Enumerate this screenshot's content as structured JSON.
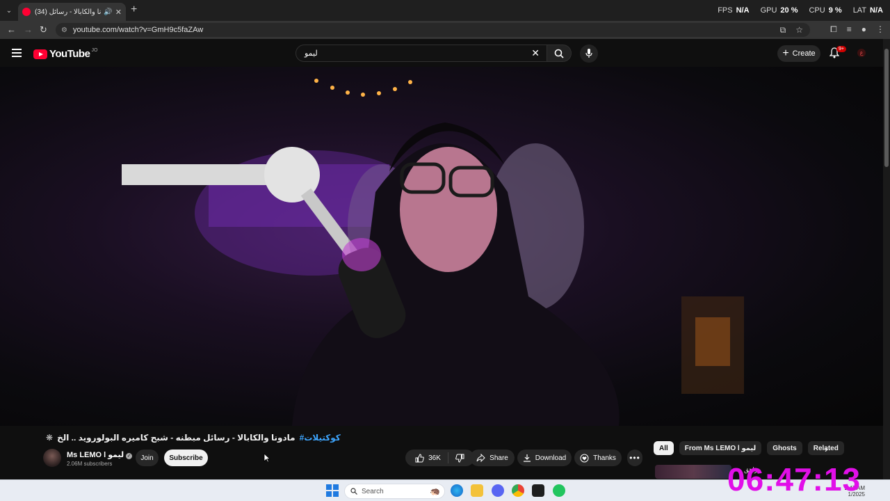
{
  "browser": {
    "tab_title": "(34) مادونا والكابالا - رسائل ...",
    "url": "youtube.com/watch?v=GmH9c5faZAw",
    "stats": [
      {
        "label": "FPS",
        "value": "N/A"
      },
      {
        "label": "GPU",
        "value": "20 %"
      },
      {
        "label": "CPU",
        "value": "9 %"
      },
      {
        "label": "LAT",
        "value": "N/A"
      }
    ]
  },
  "youtube": {
    "logo_text": "YouTube",
    "country_code": "JO",
    "search_value": "ليمو",
    "create_label": "Create",
    "notifications_badge": "9+"
  },
  "video": {
    "title_hashtag": "#كوكتيلات",
    "title_text": "مادونا والكابالا - رسائل مبطنه - شبح كاميره البولورويد .. الخ",
    "channel_name": "Ms LEMO l ليمو",
    "subscribers": "2.06M subscribers",
    "join_label": "Join",
    "subscribe_label": "Subscribe",
    "likes": "36K",
    "share_label": "Share",
    "download_label": "Download",
    "thanks_label": "Thanks",
    "more_label": "•••"
  },
  "sidebar": {
    "chips": [
      "All",
      "From Ms LEMO l ليمو",
      "Ghosts",
      "Related"
    ],
    "rec_title_fragment": "... مراهق"
  },
  "overlay": {
    "clock": "06:47:13"
  },
  "taskbar": {
    "search_placeholder": "Search",
    "tray_time": "2:47 AM",
    "tray_date": "1/2025"
  }
}
